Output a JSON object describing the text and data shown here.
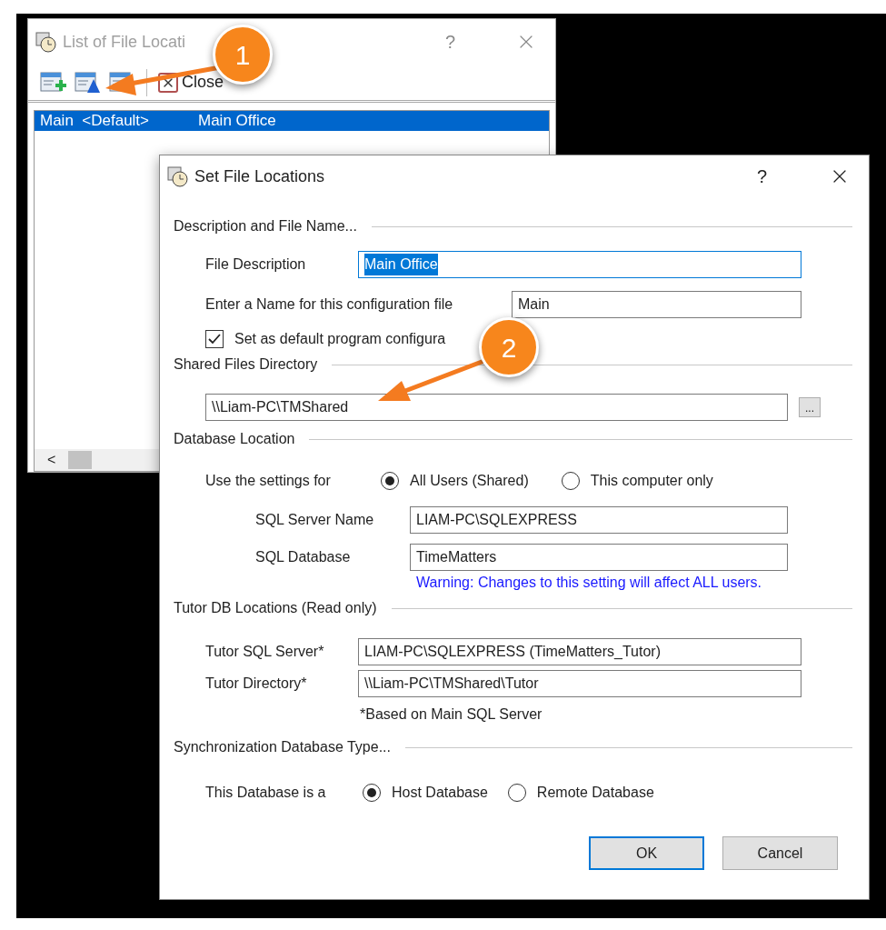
{
  "list_window": {
    "title": "List of File Locati",
    "help": "?",
    "toolbar": {
      "close_label": "Close"
    },
    "rows": [
      {
        "column_1": "Main  <Default>",
        "column_2": "Main Office",
        "selected": true
      }
    ],
    "scroll_left": "<"
  },
  "dialog": {
    "title": "Set File Locations",
    "help": "?",
    "description": {
      "heading": "Description and File Name...",
      "file_description_label": "File Description",
      "file_description_value": "Main Office",
      "value_selected": true,
      "config_name_label": "Enter a Name for this configuration file",
      "config_name_value": "Main",
      "default_checkbox": {
        "label": "Set as default program configura",
        "checked": true
      }
    },
    "shared": {
      "heading": "Shared Files Directory",
      "value": "\\\\Liam-PC\\TMShared",
      "browse": "..."
    },
    "database": {
      "heading": "Database Location",
      "use_label": "Use the settings for",
      "options": [
        {
          "label": "All Users (Shared)",
          "selected": true
        },
        {
          "label": "This computer only",
          "selected": false
        }
      ],
      "server_label": "SQL Server Name",
      "server_value": "LIAM-PC\\SQLEXPRESS",
      "db_label": "SQL Database",
      "db_value": "TimeMatters",
      "warning": "Warning: Changes to this setting will affect ALL users."
    },
    "tutor": {
      "heading": "Tutor DB Locations (Read only)",
      "server_label": "Tutor SQL Server*",
      "server_value": "LIAM-PC\\SQLEXPRESS (TimeMatters_Tutor)",
      "dir_label": "Tutor Directory*",
      "dir_value": "\\\\Liam-PC\\TMShared\\Tutor",
      "note": "*Based on Main SQL Server"
    },
    "sync": {
      "heading": "Synchronization Database Type...",
      "label": "This Database is a",
      "options": [
        {
          "label": "Host Database",
          "selected": true
        },
        {
          "label": "Remote Database",
          "selected": false
        }
      ]
    },
    "buttons": [
      {
        "label": "OK",
        "default": true
      },
      {
        "label": "Cancel",
        "default": false
      }
    ]
  },
  "callouts": [
    {
      "number": "1"
    },
    {
      "number": "2"
    }
  ]
}
